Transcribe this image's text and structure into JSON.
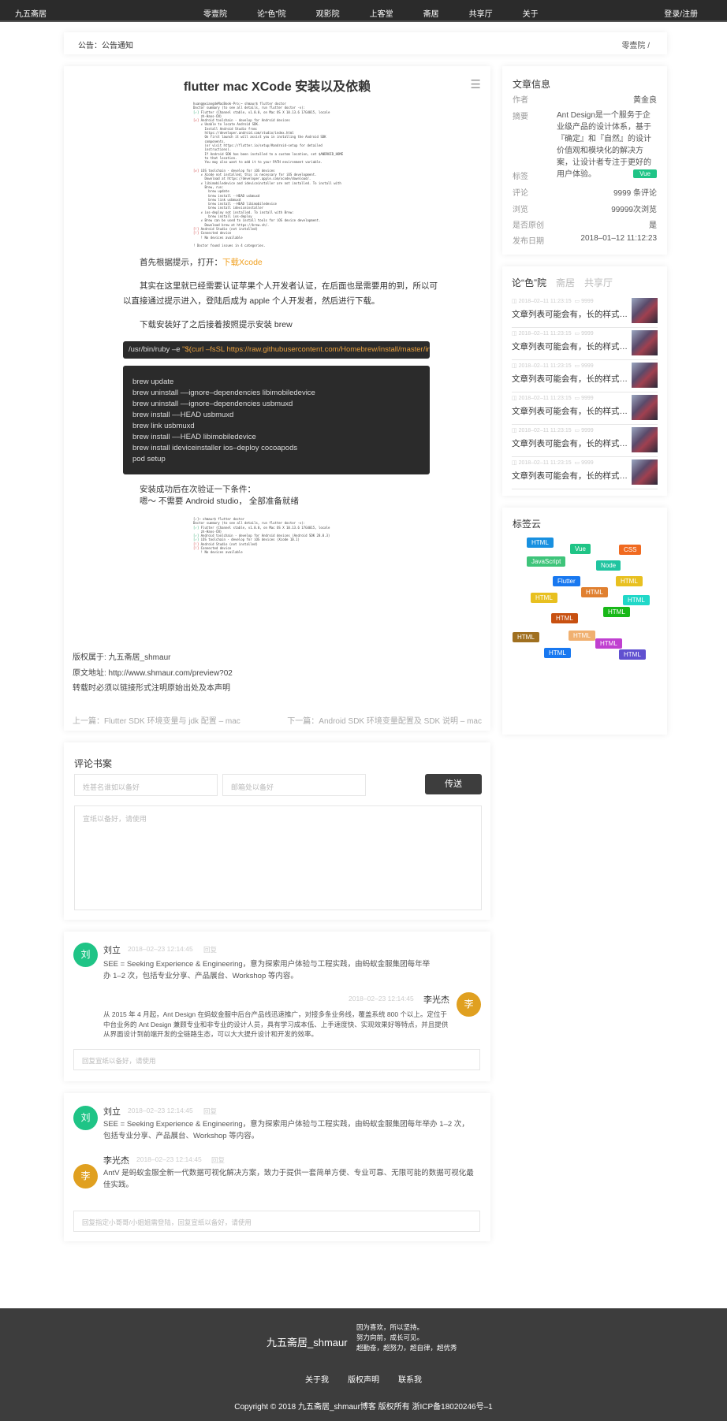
{
  "nav": {
    "logo": "九五斋居",
    "menu": [
      "零壹院",
      "论“色”院",
      "观影院",
      "上客堂",
      "斋居",
      "共享厅",
      "关于"
    ],
    "login": "登录/注册"
  },
  "notice": {
    "label": "公告：公告通知",
    "breadcrumb": "零壹院 /"
  },
  "article": {
    "title": "flutter mac XCode 安装以及依赖",
    "p1_prefix": "首先根据提示，打开：",
    "p1_link": "下载Xcode",
    "p2_line1": "其实在这里就已经需要认证苹果个人开发者认证，在后面也是需要用的到，所以可",
    "p2_line2": "以直接通过提示进入，登陆后成为 apple 个人开发者，然后进行下载。",
    "p3": "下载安装好了之后接着按照提示安装 brew",
    "cmd1_prefix": "/usr/bin/ruby –e ",
    "cmd1_arg": "\"$(curl –fsSL https://raw.githubusercontent.com/Homebrew/install/master/ins",
    "cmd2": [
      "brew update",
      "brew uninstall ––ignore–dependencies libimobiledevice",
      "brew uninstall ––ignore–dependencies usbmuxd",
      "brew install ––HEAD usbmuxd",
      "brew link usbmuxd",
      "brew install ––HEAD libimobiledevice",
      "brew install ideviceinstaller ios–deploy cocoapods",
      "pod setup"
    ],
    "p4_line1": "安装成功后在次验证一下条件：",
    "p4_line2": "嗯～ 不需要 Android studio，  全部准备就绪",
    "copyright1": "版权属于: 九五斋居_shmaur",
    "copyright2": "原文地址: http://www.shmaur.com/preview?02",
    "copyright3": "转载时必须以链接形式注明原始出处及本声明",
    "prev": "上一篇：Flutter SDK 环境变量与 jdk 配置 – mac",
    "next": "下一篇：Android SDK 环境变量配置及 SDK 说明 – mac"
  },
  "info": {
    "heading": "文章信息",
    "author_k": "作者",
    "author_v": "黄金良",
    "summary_k": "摘要",
    "summary_v": "Ant Design是一个服务于企业级产品的设计体系，基于『确定』和『自然』的设计价值观和模块化的解决方案，让设计者专注于更好的用户体验。",
    "tag_k": "标签",
    "tag_v": "Vue",
    "comment_k": "评论",
    "comment_v": "9999 条评论",
    "view_k": "浏览",
    "view_v": "99999次浏览",
    "orig_k": "是否原创",
    "orig_v": "是",
    "date_k": "发布日期",
    "date_v": "2018–01–12 11:12:23"
  },
  "side_list": {
    "tabs": [
      "论“色”院",
      "斋居",
      "共享厅"
    ],
    "items": [
      {
        "date": "2018–02–11 11:23:15",
        "count": "9999",
        "title": "文章列表可能会有，长的样式…"
      },
      {
        "date": "2018–02–11 11:23:15",
        "count": "9999",
        "title": "文章列表可能会有，长的样式…"
      },
      {
        "date": "2018–02–11 11:23:15",
        "count": "9999",
        "title": "文章列表可能会有，长的样式…"
      },
      {
        "date": "2018–02–11 11:23:15",
        "count": "9999",
        "title": "文章列表可能会有，长的样式…"
      },
      {
        "date": "2018–02–11 11:23:15",
        "count": "9999",
        "title": "文章列表可能会有，长的样式…"
      },
      {
        "date": "2018–02–11 11:23:15",
        "count": "9999",
        "title": "文章列表可能会有，长的样式…"
      }
    ]
  },
  "tag_cloud": {
    "heading": "标签云",
    "tags": [
      {
        "text": "HTML",
        "color": "#1890e0"
      },
      {
        "text": "Vue",
        "color": "#1fc486"
      },
      {
        "text": "CSS",
        "color": "#f06a20"
      },
      {
        "text": "JavaScript",
        "color": "#3ec47a"
      },
      {
        "text": "Node",
        "color": "#20c4a0"
      },
      {
        "text": "Flutter",
        "color": "#1878f0"
      },
      {
        "text": "HTML",
        "color": "#e8c020"
      },
      {
        "text": "HTML",
        "color": "#e8c020"
      },
      {
        "text": "HTML",
        "color": "#e08030"
      },
      {
        "text": "HTML",
        "color": "#20d8c8"
      },
      {
        "text": "HTML",
        "color": "#18b818"
      },
      {
        "text": "HTML",
        "color": "#c85010"
      },
      {
        "text": "HTML",
        "color": "#f0b070"
      },
      {
        "text": "HTML",
        "color": "#a07020"
      },
      {
        "text": "HTML",
        "color": "#c040d0"
      },
      {
        "text": "HTML",
        "color": "#1878f0"
      },
      {
        "text": "HTML",
        "color": "#6050d0"
      }
    ]
  },
  "comment_form": {
    "heading": "评论书案",
    "name_placeholder": "姓甚名谁如以备好",
    "email_placeholder": "邮箱处以备好",
    "send": "传送",
    "content_placeholder": "宣纸以备好，请使用"
  },
  "threads": [
    {
      "name": "刘立",
      "avatar": "刘",
      "date": "2018–02–23 12:14:45",
      "reply": "回复",
      "text": "SEE = Seeking Experience & Engineering，意为探索用户体验与工程实践，由蚂蚁金服集团每年举办 1–2 次，包括专业分享、产品展台、Workshop 等内容。",
      "sub": {
        "name": "李光杰",
        "avatar": "李",
        "date": "2018–02–23 12:14:45",
        "text": "从 2015 年 4 月起，Ant Design 在蚂蚁金服中后台产品线迅速推广，对接多条业务线，覆盖系统 800 个以上。定位于中台业务的 Ant Design 兼顾专业和非专业的设计人员，具有学习成本低、上手速度快、实现效果好等特点，并且提供从界面设计到前端开发的全链路生态，可以大大提升设计和开发的效率。"
      },
      "reply_placeholder": "回复宣纸以备好，请使用"
    },
    {
      "name": "刘立",
      "avatar": "刘",
      "date": "2018–02–23 12:14:45",
      "reply": "回复",
      "text": "SEE = Seeking Experience & Engineering，意为探索用户体验与工程实践，由蚂蚁金服集团每年举办 1–2 次，包括专业分享、产品展台、Workshop 等内容。",
      "sub": {
        "name": "李光杰",
        "avatar": "李",
        "date": "2018–02–23 12:14:45",
        "reply": "回复",
        "text": "AntV 是蚂蚁金服全新一代数据可视化解决方案，致力于提供一套简单方便、专业可靠、无限可能的数据可视化最佳实践。"
      },
      "reply_placeholder": "回复指定小哥哥/小姐姐需登陆，回复宣纸以备好，请使用"
    }
  ],
  "footer": {
    "brand": "九五斋居_shmaur",
    "motto": [
      "因为喜欢，所以坚持。",
      "努力向前，成长可见。",
      "超勤奋，超努力，超自律，超优秀"
    ],
    "links": [
      "关于我",
      "版权声明",
      "联系我"
    ],
    "copyright": "Copyright © 2018 九五斋居_shmaur博客 版权所有 浙ICP备18020246号–1"
  }
}
